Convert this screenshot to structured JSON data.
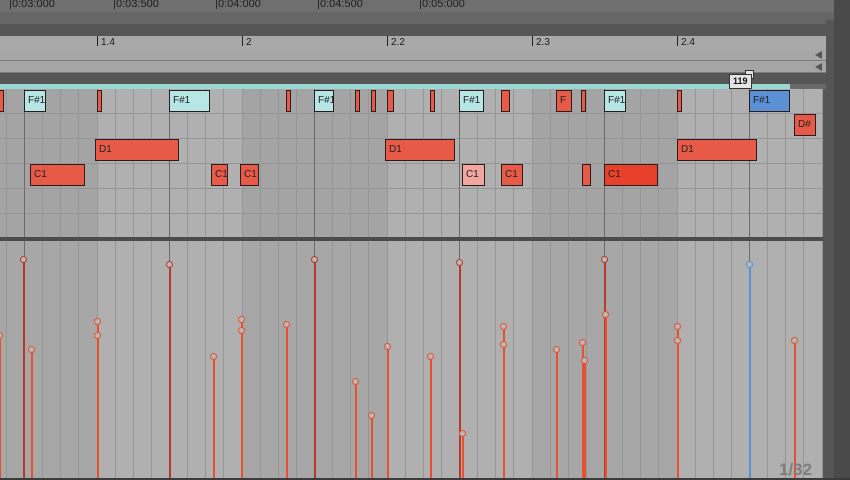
{
  "timeline": {
    "labels": [
      "0:03:000",
      "0:03:500",
      "0:04:000",
      "0:04:500",
      "0:05:000"
    ]
  },
  "ruler": {
    "labels": [
      "1.4",
      "2",
      "2.2",
      "2.3",
      "2.4"
    ]
  },
  "loop_marker": {
    "value": "119"
  },
  "notes": [
    {
      "label": "",
      "row": 0,
      "beat_start": 0.0,
      "beat_len": 0.02,
      "color": "#e85a48"
    },
    {
      "label": "F#1",
      "row": 0,
      "beat_start": 0.17,
      "beat_len": 0.15,
      "color": "#b6e6e6"
    },
    {
      "label": "",
      "row": 0,
      "beat_start": 0.67,
      "beat_len": 0.03,
      "color": "#e85a48"
    },
    {
      "label": "F#1",
      "row": 0,
      "beat_start": 1.17,
      "beat_len": 0.28,
      "color": "#b6e6e6"
    },
    {
      "label": "",
      "row": 0,
      "beat_start": 1.98,
      "beat_len": 0.03,
      "color": "#e85a48"
    },
    {
      "label": "F#1",
      "row": 0,
      "beat_start": 2.17,
      "beat_len": 0.14,
      "color": "#b6e6e6"
    },
    {
      "label": "",
      "row": 0,
      "beat_start": 2.45,
      "beat_len": 0.03,
      "color": "#e85a48"
    },
    {
      "label": "",
      "row": 0,
      "beat_start": 2.56,
      "beat_len": 0.03,
      "color": "#e85a48"
    },
    {
      "label": "",
      "row": 0,
      "beat_start": 2.67,
      "beat_len": 0.05,
      "color": "#e85a48"
    },
    {
      "label": "",
      "row": 0,
      "beat_start": 2.97,
      "beat_len": 0.03,
      "color": "#e85a48"
    },
    {
      "label": "F#1",
      "row": 0,
      "beat_start": 3.17,
      "beat_len": 0.17,
      "color": "#b6e6e6"
    },
    {
      "label": "",
      "row": 0,
      "beat_start": 3.46,
      "beat_len": 0.06,
      "color": "#e85a48"
    },
    {
      "label": "F",
      "row": 0,
      "beat_start": 3.84,
      "beat_len": 0.11,
      "color": "#e85a48"
    },
    {
      "label": "",
      "row": 0,
      "beat_start": 4.01,
      "beat_len": 0.03,
      "color": "#e85a48"
    },
    {
      "label": "F#1",
      "row": 0,
      "beat_start": 4.17,
      "beat_len": 0.15,
      "color": "#b6e6e6"
    },
    {
      "label": "",
      "row": 0,
      "beat_start": 4.67,
      "beat_len": 0.03,
      "color": "#e85a48"
    },
    {
      "label": "F#1",
      "row": 0,
      "beat_start": 5.17,
      "beat_len": 0.28,
      "color": "#5b8fd6"
    },
    {
      "label": "D#",
      "row": 1,
      "beat_start": 5.48,
      "beat_len": 0.15,
      "color": "#e85a48"
    },
    {
      "label": "D1",
      "row": 2,
      "beat_start": 0.66,
      "beat_len": 0.58,
      "color": "#e85a48"
    },
    {
      "label": "D1",
      "row": 2,
      "beat_start": 2.66,
      "beat_len": 0.48,
      "color": "#e85a48"
    },
    {
      "label": "D1",
      "row": 2,
      "beat_start": 4.67,
      "beat_len": 0.55,
      "color": "#e85a48"
    },
    {
      "label": "C1",
      "row": 3,
      "beat_start": 0.21,
      "beat_len": 0.38,
      "color": "#e85a48"
    },
    {
      "label": "C1",
      "row": 3,
      "beat_start": 1.46,
      "beat_len": 0.12,
      "color": "#e85a48"
    },
    {
      "label": "C1",
      "row": 3,
      "beat_start": 1.66,
      "beat_len": 0.13,
      "color": "#e85a48"
    },
    {
      "label": "C1",
      "row": 3,
      "beat_start": 3.19,
      "beat_len": 0.16,
      "color": "#f3a6a0"
    },
    {
      "label": "C1",
      "row": 3,
      "beat_start": 3.46,
      "beat_len": 0.15,
      "color": "#e85a48"
    },
    {
      "label": "",
      "row": 3,
      "beat_start": 4.02,
      "beat_len": 0.06,
      "color": "#e85a48"
    },
    {
      "label": "C1",
      "row": 3,
      "beat_start": 4.17,
      "beat_len": 0.37,
      "color": "#e8402a"
    }
  ],
  "velocities": [
    {
      "beat": 0.0,
      "vel": 0.62,
      "color": "#e8502e"
    },
    {
      "beat": 0.16,
      "vel": 0.95,
      "color": "#b8382a"
    },
    {
      "beat": 0.22,
      "vel": 0.56,
      "color": "#e8502e"
    },
    {
      "beat": 0.67,
      "vel": 0.68,
      "color": "#e8502e"
    },
    {
      "beat": 0.67,
      "vel": 0.62,
      "color": "#e8502e"
    },
    {
      "beat": 1.17,
      "vel": 0.93,
      "color": "#b8382a"
    },
    {
      "beat": 1.47,
      "vel": 0.53,
      "color": "#e8502e"
    },
    {
      "beat": 1.67,
      "vel": 0.69,
      "color": "#e8502e"
    },
    {
      "beat": 1.67,
      "vel": 0.64,
      "color": "#e8502e"
    },
    {
      "beat": 1.98,
      "vel": 0.67,
      "color": "#e8502e"
    },
    {
      "beat": 2.17,
      "vel": 0.95,
      "color": "#b8382a"
    },
    {
      "beat": 2.45,
      "vel": 0.42,
      "color": "#e8502e"
    },
    {
      "beat": 2.56,
      "vel": 0.27,
      "color": "#e8502e"
    },
    {
      "beat": 2.67,
      "vel": 0.57,
      "color": "#e8502e"
    },
    {
      "beat": 2.97,
      "vel": 0.53,
      "color": "#e8502e"
    },
    {
      "beat": 3.17,
      "vel": 0.94,
      "color": "#b8382a"
    },
    {
      "beat": 3.19,
      "vel": 0.19,
      "color": "#e8502e"
    },
    {
      "beat": 3.47,
      "vel": 0.66,
      "color": "#e8502e"
    },
    {
      "beat": 3.47,
      "vel": 0.58,
      "color": "#e8502e"
    },
    {
      "beat": 3.84,
      "vel": 0.56,
      "color": "#e8502e"
    },
    {
      "beat": 4.02,
      "vel": 0.59,
      "color": "#e8502e"
    },
    {
      "beat": 4.03,
      "vel": 0.51,
      "color": "#e8502e"
    },
    {
      "beat": 4.17,
      "vel": 0.95,
      "color": "#b8382a"
    },
    {
      "beat": 4.18,
      "vel": 0.71,
      "color": "#e8502e"
    },
    {
      "beat": 4.67,
      "vel": 0.66,
      "color": "#e8502e"
    },
    {
      "beat": 4.67,
      "vel": 0.6,
      "color": "#e8502e"
    },
    {
      "beat": 5.17,
      "vel": 0.93,
      "color": "#5b8fd6"
    },
    {
      "beat": 5.48,
      "vel": 0.6,
      "color": "#e8502e"
    }
  ],
  "page_indicator": "1/32"
}
